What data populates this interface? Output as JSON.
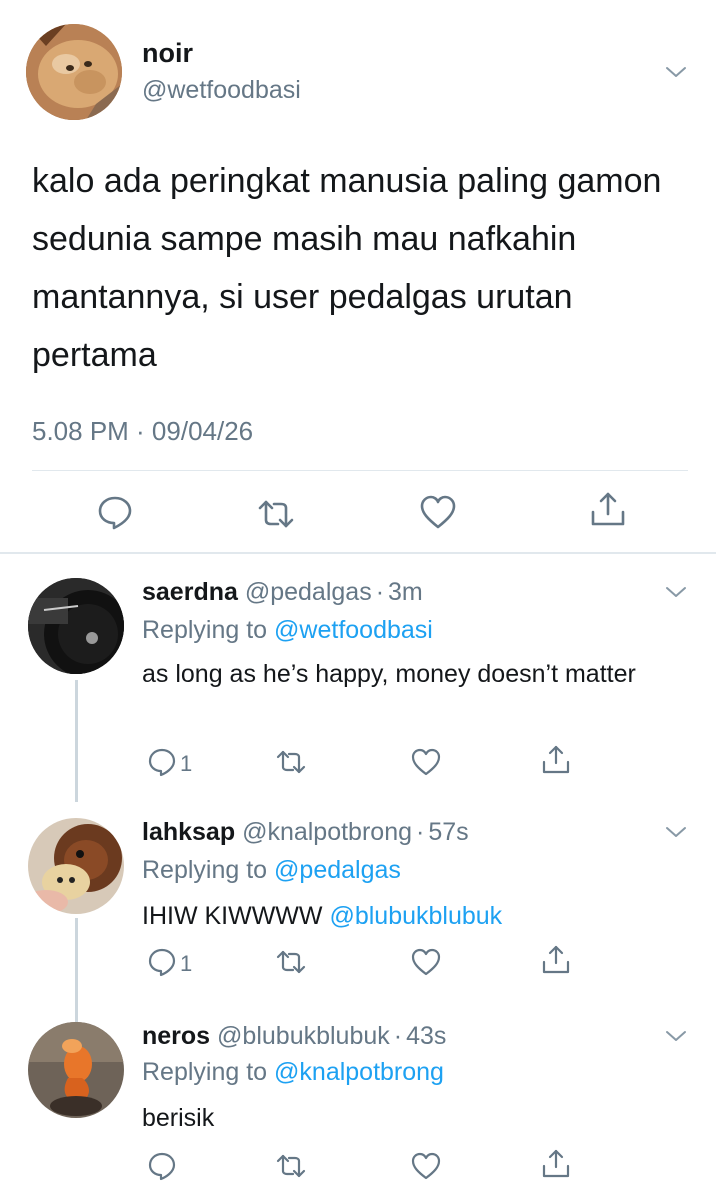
{
  "main_tweet": {
    "display_name": "noir",
    "handle": "@wetfoodbasi",
    "text": "kalo ada peringkat manusia paling gamon sedunia sampe masih mau nafkahin mantannya, si user pedalgas urutan pertama",
    "timestamp": "5.08 PM · 09/04/26",
    "actions": [
      "reply-icon",
      "retweet-icon",
      "like-icon",
      "share-icon"
    ]
  },
  "replies": [
    {
      "display_name": "saerdna",
      "handle": "@pedalgas",
      "separator": "·",
      "time": "3m",
      "replying_prefix": "Replying to",
      "replying_to": "@wetfoodbasi",
      "text": "as long as he’s happy, money doesn’t matter",
      "reply_count": "1"
    },
    {
      "display_name": "lahksap",
      "handle": "@knalpotbrong",
      "separator": "·",
      "time": "57s",
      "replying_prefix": "Replying to",
      "replying_to": "@pedalgas",
      "text": "IHIW KIWWWW",
      "mention": "@blubukblubuk",
      "reply_count": "1"
    },
    {
      "display_name": "neros",
      "handle": "@blubukblubuk",
      "separator": "·",
      "time": "43s",
      "replying_prefix": "Replying to",
      "replying_to": "@knalpotbrong",
      "text": "berisik",
      "reply_count": ""
    }
  ],
  "colors": {
    "text": "#14171a",
    "secondary": "#657786",
    "link": "#1da1f2",
    "divider": "#e1e8ed",
    "thread_line": "#ccd6dd"
  }
}
